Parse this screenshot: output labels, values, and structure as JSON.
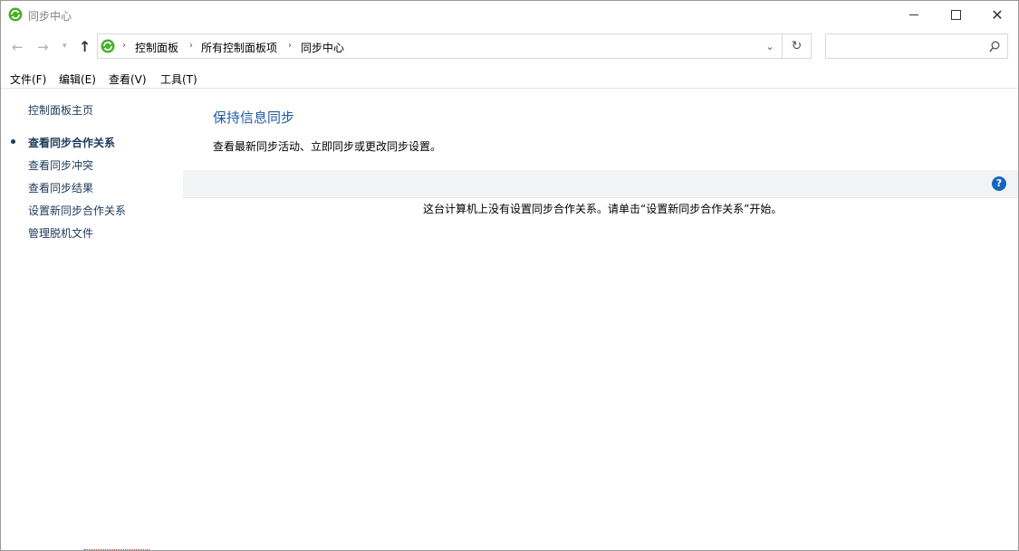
{
  "window": {
    "title": "同步中心"
  },
  "nav": {
    "breadcrumbs": [
      "控制面板",
      "所有控制面板项",
      "同步中心"
    ],
    "search_placeholder": ""
  },
  "menu": [
    "文件(F)",
    "编辑(E)",
    "查看(V)",
    "工具(T)"
  ],
  "sidebar": {
    "home": "控制面板主页",
    "items": [
      "查看同步合作关系",
      "查看同步冲突",
      "查看同步结果",
      "设置新同步合作关系",
      "管理脱机文件"
    ],
    "current_index": 0
  },
  "main": {
    "title": "保持信息同步",
    "description": "查看最新同步活动、立即同步或更改同步设置。",
    "empty_message": "这台计算机上没有设置同步合作关系。请单击“设置新同步合作关系”开始。"
  },
  "colors": {
    "accent": "#1e5aa0",
    "link": "#1e395b",
    "icon_green": "#4caf28",
    "help_blue": "#1565c0"
  }
}
